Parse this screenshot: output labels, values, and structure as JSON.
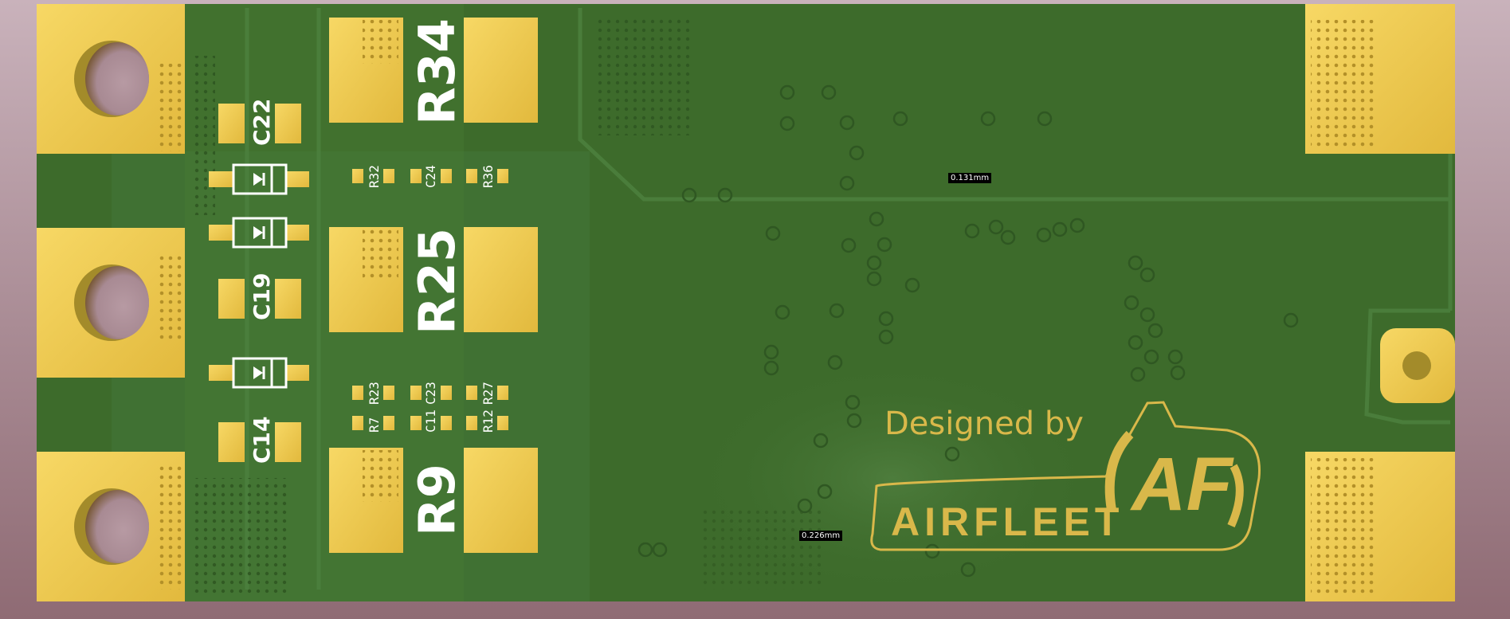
{
  "board": {
    "branding": {
      "tagline": "Designed by",
      "company": "AIRFLEET",
      "logo_mark": "AF"
    },
    "measurements": [
      {
        "id": "m1",
        "text": "0.131mm"
      },
      {
        "id": "m2",
        "text": "0.226mm"
      }
    ],
    "designators": {
      "large_resistors": [
        "R34",
        "R25",
        "R9"
      ],
      "capacitors": [
        "C22",
        "C19",
        "C14"
      ],
      "row_top_small": [
        "R32",
        "C24",
        "R36"
      ],
      "row_mid_small": [
        "R23",
        "C23",
        "R27"
      ],
      "row_bot_small": [
        "R7",
        "C11",
        "R12"
      ]
    },
    "colors": {
      "board_green": "#3d6b2b",
      "copper_gold": "#e8c34a",
      "silkscreen": "#ffffff",
      "background_pink": "#b89aa3"
    },
    "icons": [
      "mounting-hole-icon",
      "diode-icon",
      "via-icon"
    ]
  }
}
